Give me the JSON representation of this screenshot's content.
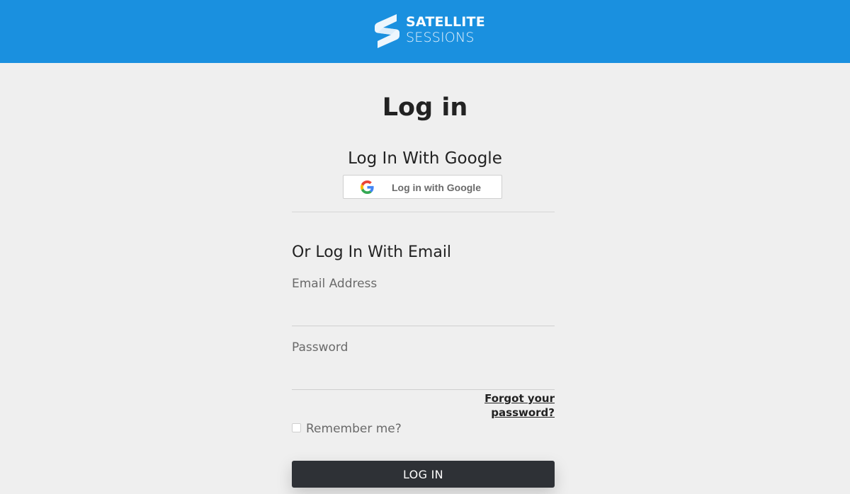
{
  "header": {
    "logo": {
      "line1": "SATELLITE",
      "line2": "SESSIONS",
      "icon": "satellite-s-logo-icon"
    },
    "background": "#1a90df"
  },
  "page": {
    "title": "Log in"
  },
  "google": {
    "heading": "Log In With Google",
    "button_label": "Log in with Google",
    "icon": "google-g-icon"
  },
  "email": {
    "heading": "Or Log In With Email",
    "email_label": "Email Address",
    "email_value": "",
    "password_label": "Password",
    "password_value": "",
    "forgot_link": "Forgot your password?",
    "remember_label": "Remember me?",
    "remember_checked": false,
    "submit_label": "LOG IN"
  },
  "colors": {
    "accent": "#1a90df",
    "button_dark": "#2e3136",
    "background": "#efefef"
  }
}
